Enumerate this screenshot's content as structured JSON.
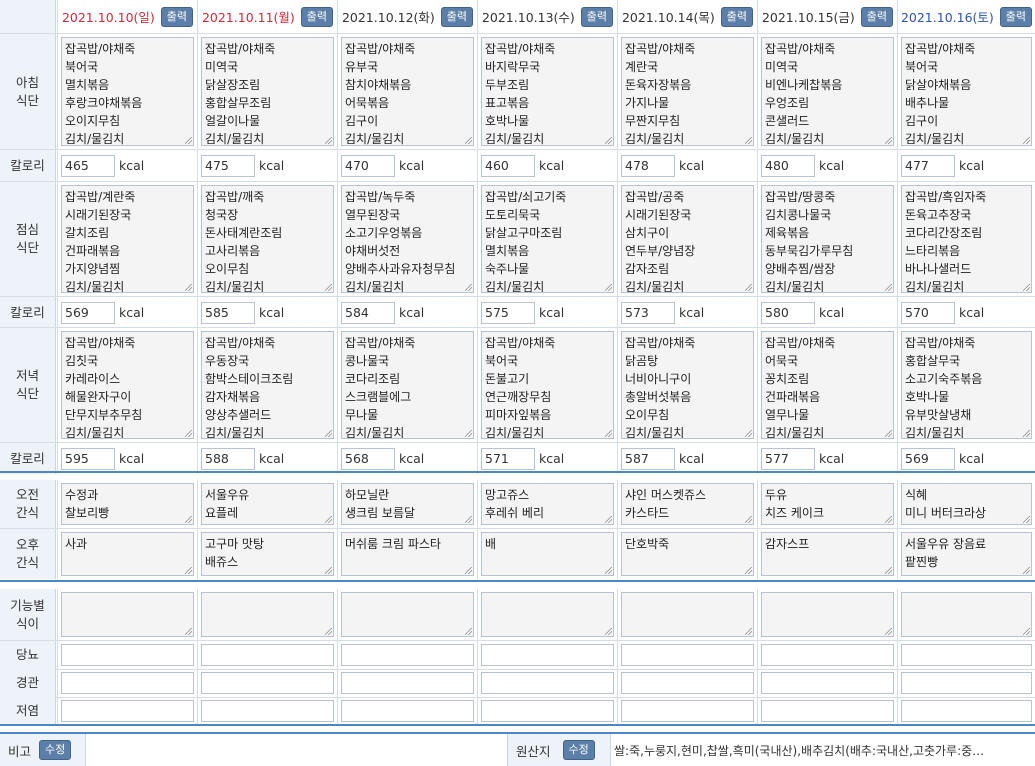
{
  "print_label": "출력",
  "kcal_unit": "kcal",
  "days": [
    {
      "date": "2021.10.10(일)",
      "color": "#d4283a"
    },
    {
      "date": "2021.10.11(월)",
      "color": "#d4283a"
    },
    {
      "date": "2021.10.12(화)",
      "color": "#333333"
    },
    {
      "date": "2021.10.13(수)",
      "color": "#333333"
    },
    {
      "date": "2021.10.14(목)",
      "color": "#333333"
    },
    {
      "date": "2021.10.15(금)",
      "color": "#333333"
    },
    {
      "date": "2021.10.16(토)",
      "color": "#2d55b8"
    }
  ],
  "labels": {
    "breakfast": "아침\n식단",
    "lunch": "점심\n식단",
    "dinner": "저녁\n식단",
    "calorie": "칼로리",
    "am_snack": "오전\n간식",
    "pm_snack": "오후\n간식",
    "functional": "기능별\n식이",
    "diabetes": "당뇨",
    "tube": "경관",
    "low_salt": "저염"
  },
  "breakfast": [
    "잡곡밥/야채죽\n북어국\n멸치볶음\n후랑크야채볶음\n오이지무침\n김치/물김치",
    "잡곡밥/야채죽\n미역국\n닭살장조림\n홍합살무조림\n얼갈이나물\n김치/물김치",
    "잡곡밥/야채죽\n유부국\n참치야채볶음\n어묵볶음\n김구이\n김치/물김치",
    "잡곡밥/야채죽\n바지락무국\n두부조림\n표고볶음\n호박나물\n김치/물김치",
    "잡곡밥/야채죽\n계란국\n돈육자장볶음\n가지나물\n무짠지무침\n김치/물김치",
    "잡곡밥/야채죽\n미역국\n비엔나케찹볶음\n우엉조림\n콘샐러드\n김치/물김치",
    "잡곡밥/야채죽\n북어국\n닭살야채볶음\n배추나물\n김구이\n김치/물김치"
  ],
  "breakfast_kcal": [
    "465",
    "475",
    "470",
    "460",
    "478",
    "480",
    "477"
  ],
  "lunch": [
    "잡곡밥/계란죽\n시래기된장국\n갈치조림\n건파래볶음\n가지양념찜\n김치/물김치",
    "잡곡밥/깨죽\n청국장\n돈사태계란조림\n고사리볶음\n오이무침\n김치/물김치",
    "잡곡밥/녹두죽\n열무된장국\n소고기우엉볶음\n야채버섯전\n양배추사과유자청무침\n김치/물김치",
    "잡곡밥/쇠고기죽\n도토리묵국\n닭살고구마조림\n멸치볶음\n숙주나물\n김치/물김치",
    "잡곡밥/공죽\n시래기된장국\n삼치구이\n연두부/양념장\n감자조림\n김치/물김치",
    "잡곡밥/땅콩죽\n김치콩나물국\n제육볶음\n동부묵김가루무침\n양배추찜/쌈장\n김치/물김치",
    "잡곡밥/흑임자죽\n돈육고추장국\n코다리간장조림\n느타리볶음\n바나나샐러드\n김치/물김치"
  ],
  "lunch_kcal": [
    "569",
    "585",
    "584",
    "575",
    "573",
    "580",
    "570"
  ],
  "dinner": [
    "잡곡밥/야채죽\n김칫국\n카레라이스\n해물완자구이\n단무지부추무침\n김치/물김치",
    "잡곡밥/야채죽\n우동장국\n함박스테이크조림\n감자채볶음\n양상추샐러드\n김치/물김치",
    "잡곡밥/야채죽\n콩나물국\n코다리조림\n스크램블에그\n무나물\n김치/물김치",
    "잡곡밥/야채죽\n북어국\n돈불고기\n연근깨장무침\n피마자잎볶음\n김치/물김치",
    "잡곡밥/야채죽\n닭곰탕\n너비아니구이\n총알버섯볶음\n오이무침\n김치/물김치",
    "잡곡밥/야채죽\n어묵국\n꽁치조림\n건파래볶음\n열무나물\n김치/물김치",
    "잡곡밥/야채죽\n홍합살무국\n소고기숙주볶음\n호박나물\n유부맛살냉채\n김치/물김치"
  ],
  "dinner_kcal": [
    "595",
    "588",
    "568",
    "571",
    "587",
    "577",
    "569"
  ],
  "am_snack": [
    "수정과\n찰보리빵",
    "서울우유\n요플레",
    "하모닐란\n생크림 보름달",
    "망고쥬스\n후레쉬 베리",
    "샤인 머스켓쥬스\n카스타드",
    "두유\n치즈 케이크",
    "식혜\n미니 버터크라상"
  ],
  "pm_snack": [
    "사과",
    "고구마 맛탕\n배쥬스",
    "머쉬룸 크림 파스타",
    "배",
    "단호박죽",
    "감자스프",
    "서울우유 장음료\n팥찐빵"
  ],
  "footer": {
    "note_label": "비고",
    "edit_label": "수정",
    "origin_label": "원산지",
    "origin_text": "쌀:죽,누룽지,현미,찹쌀,흑미(국내산),배추김치(배추:국내산,고춧가루:중…"
  }
}
